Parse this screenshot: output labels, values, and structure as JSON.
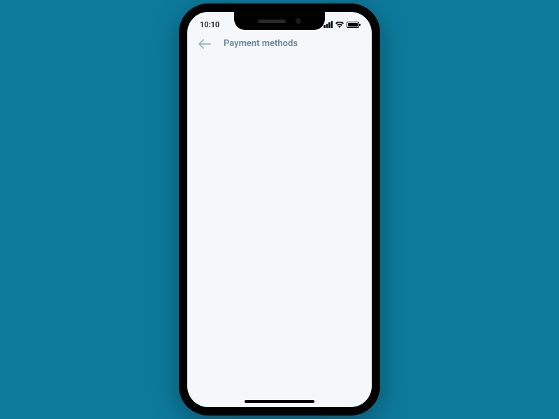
{
  "status_bar": {
    "time": "10:10"
  },
  "header": {
    "title": "Payment methods"
  }
}
